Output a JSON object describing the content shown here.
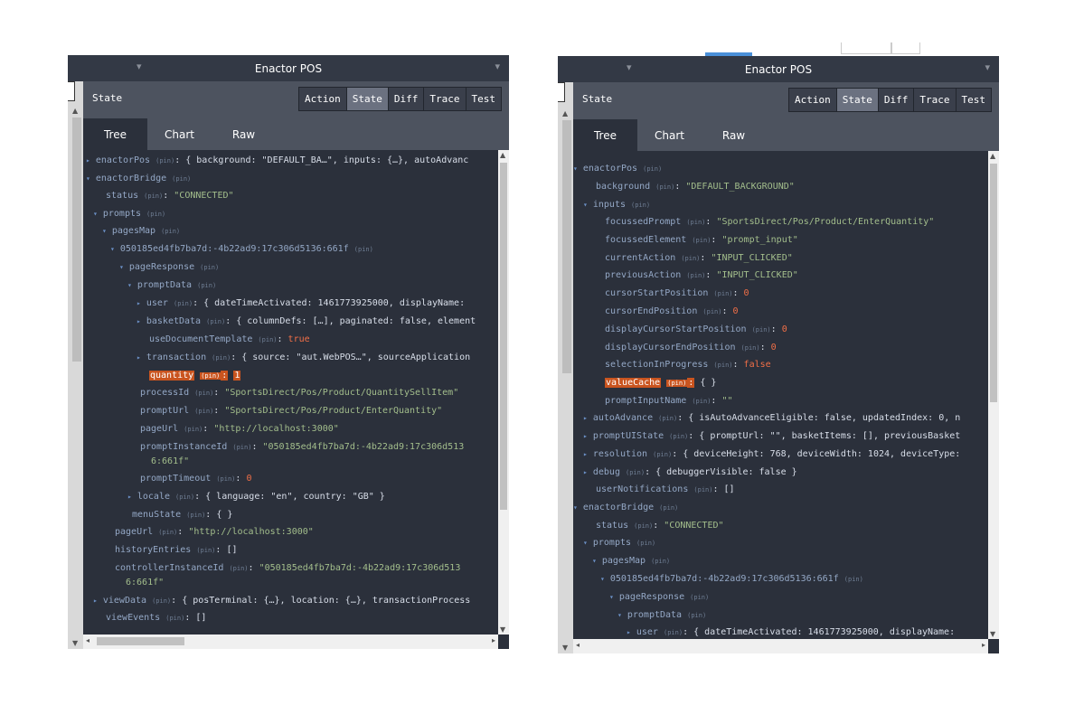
{
  "left_window": {
    "title": "Enactor POS",
    "header_label": "State",
    "buttons": [
      "Action",
      "State",
      "Diff",
      "Trace",
      "Test"
    ],
    "active_button": "State",
    "tabs": [
      "Tree",
      "Chart",
      "Raw"
    ],
    "active_tab": "Tree",
    "pin": "(pin)",
    "lines": {
      "l0_key": "enactorPos",
      "l0_val": "{ background: \"DEFAULT_BA…\", inputs: {…}, autoAdvanc",
      "l1_key": "enactorBridge",
      "l2_key": "status",
      "l2_val": "\"CONNECTED\"",
      "l3_key": "prompts",
      "l4_key": "pagesMap",
      "l5_key": "050185ed4fb7ba7d:-4b22ad9:17c306d5136:661f",
      "l6_key": "pageResponse",
      "l7_key": "promptData",
      "l8_key": "user",
      "l8_val": "{ dateTimeActivated: 1461773925000, displayName:",
      "l9_key": "basketData",
      "l9_val": "{ columnDefs: […], paginated: false, element",
      "l10_key": "useDocumentTemplate",
      "l10_val": "true",
      "l11_key": "transaction",
      "l11_val": "{ source: \"aut.WebPOS…\", sourceApplication",
      "l12_key": "quantity",
      "l12_val": "1",
      "l13_key": "processId",
      "l13_val": "\"SportsDirect/Pos/Product/QuantitySellItem\"",
      "l14_key": "promptUrl",
      "l14_val": "\"SportsDirect/Pos/Product/EnterQuantity\"",
      "l15_key": "pageUrl",
      "l15_val": "\"http://localhost:3000\"",
      "l16_key": "promptInstanceId",
      "l16_val": "\"050185ed4fb7ba7d:-4b22ad9:17c306d513",
      "l16_cont": "6:661f\"",
      "l17_key": "promptTimeout",
      "l17_val": "0",
      "l18_key": "locale",
      "l18_val": "{ language: \"en\", country: \"GB\" }",
      "l19_key": "menuState",
      "l19_val": "{ }",
      "l20_key": "pageUrl",
      "l20_val": "\"http://localhost:3000\"",
      "l21_key": "historyEntries",
      "l21_val": "[]",
      "l22_key": "controllerInstanceId",
      "l22_val": "\"050185ed4fb7ba7d:-4b22ad9:17c306d513",
      "l22_cont": "6:661f\"",
      "l23_key": "viewData",
      "l23_val": "{ posTerminal: {…}, location: {…}, transactionProcess",
      "l24_key": "viewEvents",
      "l24_val": "[]"
    }
  },
  "right_window": {
    "title": "Enactor POS",
    "header_label": "State",
    "buttons": [
      "Action",
      "State",
      "Diff",
      "Trace",
      "Test"
    ],
    "active_button": "State",
    "tabs": [
      "Tree",
      "Chart",
      "Raw"
    ],
    "active_tab": "Tree",
    "pin": "(pin)",
    "lines": {
      "r0_key": "enactorPos",
      "r1_key": "background",
      "r1_val": "\"DEFAULT_BACKGROUND\"",
      "r2_key": "inputs",
      "r3_key": "focussedPrompt",
      "r3_val": "\"SportsDirect/Pos/Product/EnterQuantity\"",
      "r4_key": "focussedElement",
      "r4_val": "\"prompt_input\"",
      "r5_key": "currentAction",
      "r5_val": "\"INPUT_CLICKED\"",
      "r6_key": "previousAction",
      "r6_val": "\"INPUT_CLICKED\"",
      "r7_key": "cursorStartPosition",
      "r7_val": "0",
      "r8_key": "cursorEndPosition",
      "r8_val": "0",
      "r9_key": "displayCursorStartPosition",
      "r9_val": "0",
      "r10_key": "displayCursorEndPosition",
      "r10_val": "0",
      "r11_key": "selectionInProgress",
      "r11_val": "false",
      "r12_key": "valueCache",
      "r12_val": "{ }",
      "r13_key": "promptInputName",
      "r13_val": "\"\"",
      "r14_key": "autoAdvance",
      "r14_val": "{ isAutoAdvanceEligible: false, updatedIndex: 0, n",
      "r15_key": "promptUIState",
      "r15_val": "{ promptUrl: \"\", basketItems: [], previousBasket",
      "r16_key": "resolution",
      "r16_val": "{ deviceHeight: 768, deviceWidth: 1024, deviceType:",
      "r17_key": "debug",
      "r17_val": "{ debuggerVisible: false }",
      "r18_key": "userNotifications",
      "r18_val": "[]",
      "r19_key": "enactorBridge",
      "r20_key": "status",
      "r20_val": "\"CONNECTED\"",
      "r21_key": "prompts",
      "r22_key": "pagesMap",
      "r23_key": "050185ed4fb7ba7d:-4b22ad9:17c306d5136:661f",
      "r24_key": "pageResponse",
      "r25_key": "promptData",
      "r26_key": "user",
      "r26_val": "{ dateTimeActivated: 1461773925000, displayName:"
    }
  },
  "icons": {
    "chevron_down": "▾",
    "arrow_right": "▸",
    "arrow_down": "▾",
    "scroll_up": "▲",
    "scroll_down": "▼",
    "scroll_left": "◂",
    "scroll_right": "▸"
  },
  "colors": {
    "bg": "#2b303b",
    "key": "#94a8c6",
    "string": "#a3be8c",
    "number": "#f26f47",
    "highlight": "#c9541f"
  }
}
